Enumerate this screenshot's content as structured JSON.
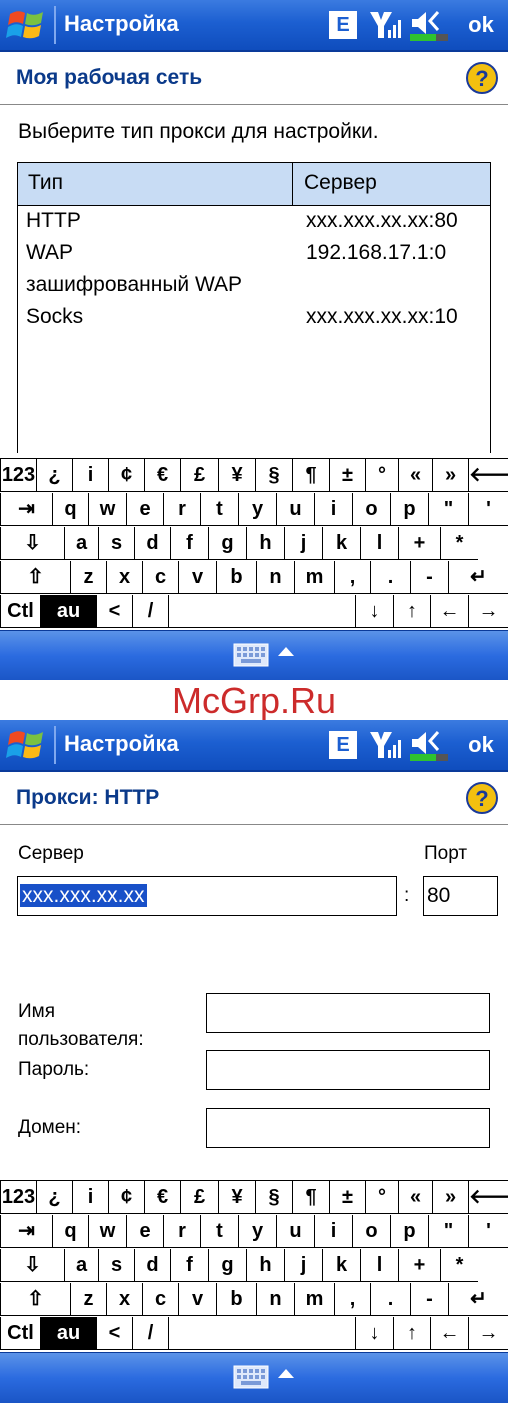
{
  "app_title": "Настройка",
  "tray": {
    "input_indicator": "E",
    "signal_icon": "signal-icon",
    "speaker_icon": "speaker-icon",
    "ok_label": "ok"
  },
  "screen1": {
    "header_title": "Моя рабочая сеть",
    "prompt": "Выберите тип прокси для настройки.",
    "list_headers": [
      "Тип",
      "Сервер"
    ],
    "list_rows": [
      {
        "type": "HTTP",
        "server": "xxx.xxx.xx.xx:80"
      },
      {
        "type": "WAP",
        "server": "192.168.17.1:0"
      },
      {
        "type": "зашифрованный WAP",
        "server": ""
      },
      {
        "type": "Socks",
        "server": "xxx.xxx.xx.xx:10"
      }
    ]
  },
  "screen2": {
    "header_title": "Прокси: HTTP",
    "server_label": "Сервер",
    "port_label": "Порт",
    "server_value": "xxx.xxx.xx.xx",
    "colon": ":",
    "port_value": "80",
    "username_label_line1": "Имя",
    "username_label_line2": "пользователя:",
    "password_label": "Пароль:",
    "domain_label": "Домен:"
  },
  "keyboard": {
    "row1": [
      "123",
      "¿",
      "i",
      "¢",
      "€",
      "£",
      "¥",
      "§",
      "¶",
      "±",
      "°",
      "«",
      "»",
      "🡐"
    ],
    "row2": [
      "⇥",
      "q",
      "w",
      "e",
      "r",
      "t",
      "y",
      "u",
      "i",
      "o",
      "p",
      "\"",
      "'"
    ],
    "row3": [
      "⇩",
      "a",
      "s",
      "d",
      "f",
      "g",
      "h",
      "j",
      "k",
      "l",
      "+",
      "*"
    ],
    "row4": [
      "⇧",
      "z",
      "x",
      "c",
      "v",
      "b",
      "n",
      "m",
      ",",
      ".",
      "-",
      "↵"
    ],
    "row5": [
      "Ctl",
      "au",
      "<",
      "/",
      "",
      "↓",
      "↑",
      "←",
      "→"
    ]
  },
  "watermark": "McGrp.Ru"
}
